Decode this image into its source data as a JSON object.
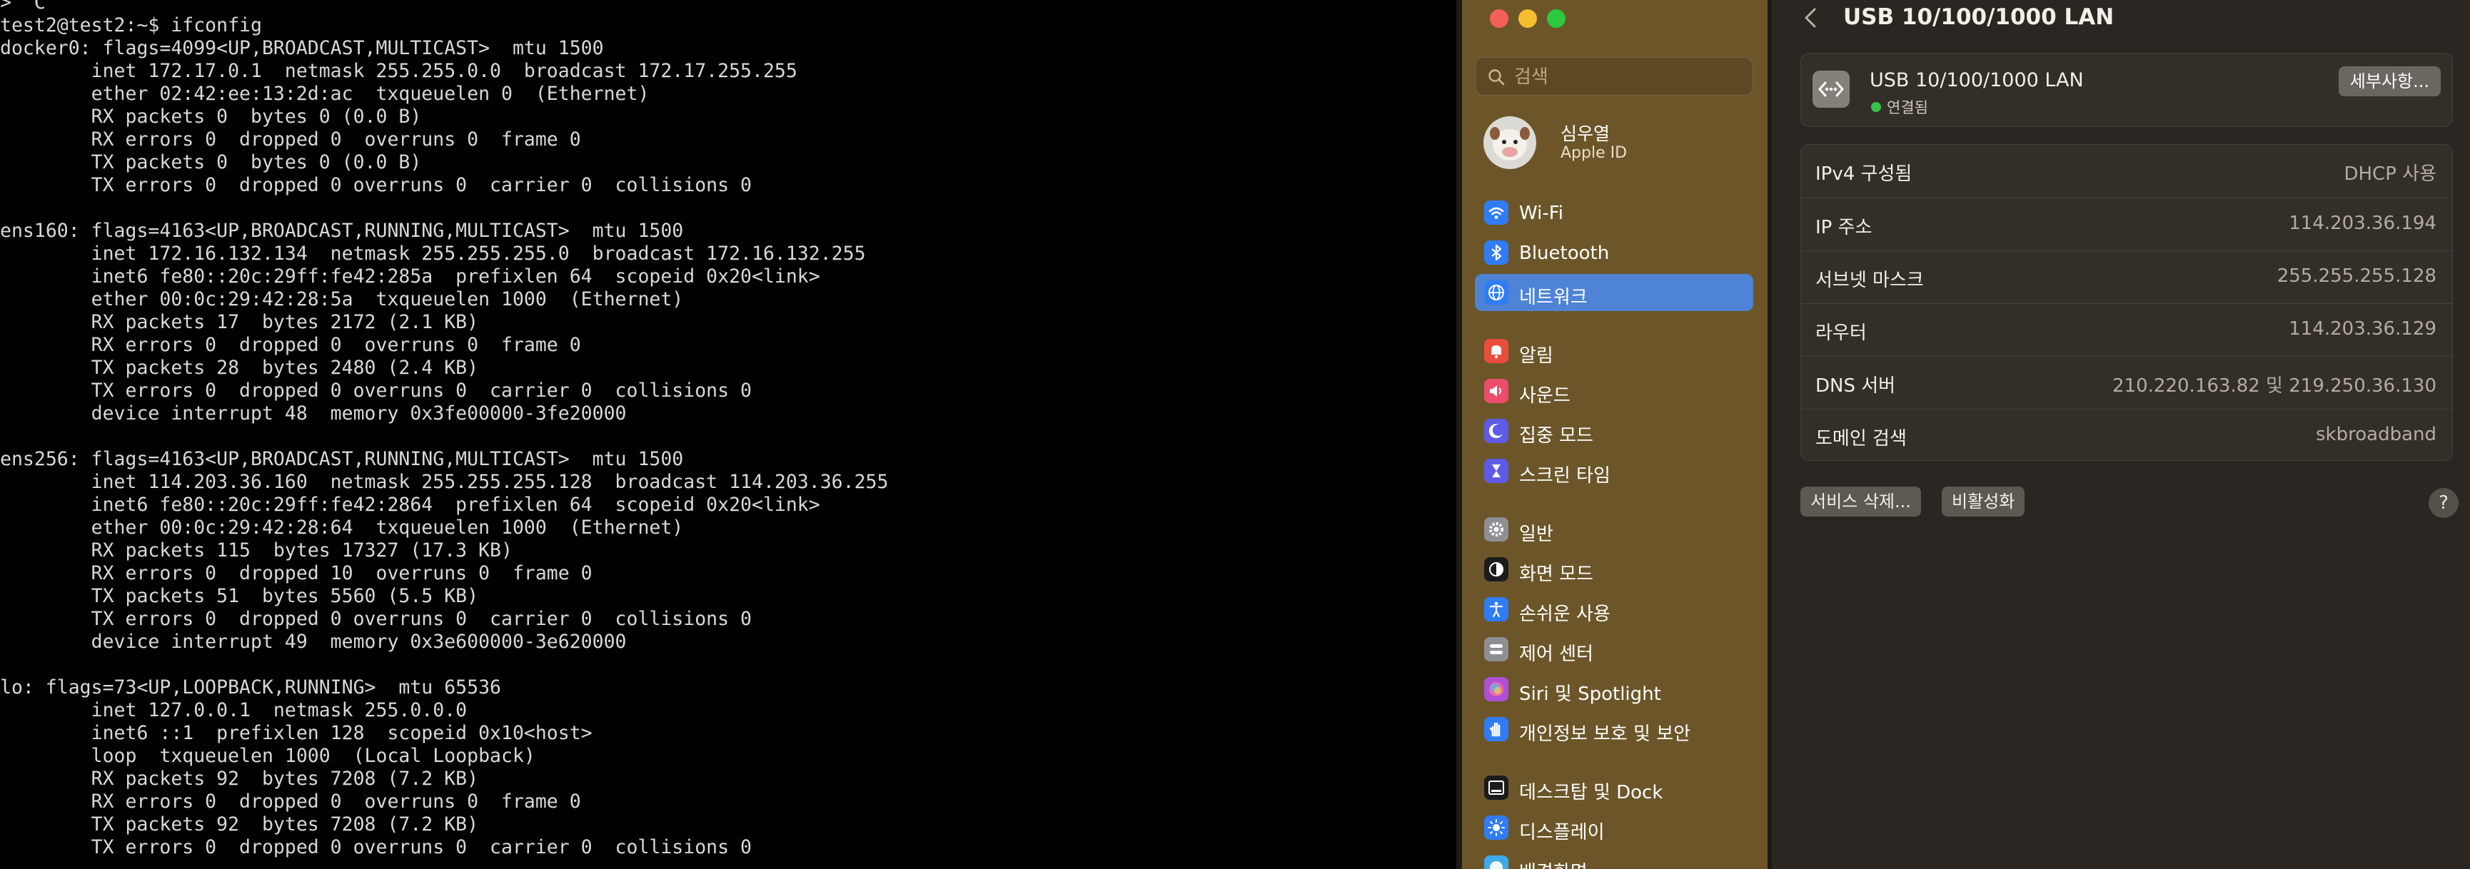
{
  "terminal": {
    "lines": [
      "> ^C",
      "test2@test2:~$ ifconfig",
      "docker0: flags=4099<UP,BROADCAST,MULTICAST>  mtu 1500",
      "        inet 172.17.0.1  netmask 255.255.0.0  broadcast 172.17.255.255",
      "        ether 02:42:ee:13:2d:ac  txqueuelen 0  (Ethernet)",
      "        RX packets 0  bytes 0 (0.0 B)",
      "        RX errors 0  dropped 0  overruns 0  frame 0",
      "        TX packets 0  bytes 0 (0.0 B)",
      "        TX errors 0  dropped 0 overruns 0  carrier 0  collisions 0",
      "",
      "ens160: flags=4163<UP,BROADCAST,RUNNING,MULTICAST>  mtu 1500",
      "        inet 172.16.132.134  netmask 255.255.255.0  broadcast 172.16.132.255",
      "        inet6 fe80::20c:29ff:fe42:285a  prefixlen 64  scopeid 0x20<link>",
      "        ether 00:0c:29:42:28:5a  txqueuelen 1000  (Ethernet)",
      "        RX packets 17  bytes 2172 (2.1 KB)",
      "        RX errors 0  dropped 0  overruns 0  frame 0",
      "        TX packets 28  bytes 2480 (2.4 KB)",
      "        TX errors 0  dropped 0 overruns 0  carrier 0  collisions 0",
      "        device interrupt 48  memory 0x3fe00000-3fe20000",
      "",
      "ens256: flags=4163<UP,BROADCAST,RUNNING,MULTICAST>  mtu 1500",
      "        inet 114.203.36.160  netmask 255.255.255.128  broadcast 114.203.36.255",
      "        inet6 fe80::20c:29ff:fe42:2864  prefixlen 64  scopeid 0x20<link>",
      "        ether 00:0c:29:42:28:64  txqueuelen 1000  (Ethernet)",
      "        RX packets 115  bytes 17327 (17.3 KB)",
      "        RX errors 0  dropped 10  overruns 0  frame 0",
      "        TX packets 51  bytes 5560 (5.5 KB)",
      "        TX errors 0  dropped 0 overruns 0  carrier 0  collisions 0",
      "        device interrupt 49  memory 0x3e600000-3e620000",
      "",
      "lo: flags=73<UP,LOOPBACK,RUNNING>  mtu 65536",
      "        inet 127.0.0.1  netmask 255.0.0.0",
      "        inet6 ::1  prefixlen 128  scopeid 0x10<host>",
      "        loop  txqueuelen 1000  (Local Loopback)",
      "        RX packets 92  bytes 7208 (7.2 KB)",
      "        RX errors 0  dropped 0  overruns 0  frame 0",
      "        TX packets 92  bytes 7208 (7.2 KB)",
      "        TX errors 0  dropped 0 overruns 0  carrier 0  collisions 0"
    ]
  },
  "sidebar": {
    "search_placeholder": "검색",
    "profile": {
      "name": "심우열",
      "subtitle": "Apple ID"
    },
    "items": [
      {
        "label": "Wi-Fi",
        "icon": "wifi-icon",
        "color": "#2f7cf6"
      },
      {
        "label": "Bluetooth",
        "icon": "bluetooth-icon",
        "color": "#2f7cf6"
      },
      {
        "label": "네트워크",
        "icon": "globe-icon",
        "color": "#2f7cf6",
        "selected": true
      },
      {
        "label": "알림",
        "icon": "bell-icon",
        "color": "#eb4d3d"
      },
      {
        "label": "사운드",
        "icon": "speaker-icon",
        "color": "#eb4d6a"
      },
      {
        "label": "집중 모드",
        "icon": "moon-icon",
        "color": "#5e5ce6"
      },
      {
        "label": "스크린 타임",
        "icon": "hourglass-icon",
        "color": "#5e5ce6"
      },
      {
        "label": "일반",
        "icon": "gear-icon",
        "color": "#8e8e93"
      },
      {
        "label": "화면 모드",
        "icon": "appearance-icon",
        "color": "#1c1c1e"
      },
      {
        "label": "손쉬운 사용",
        "icon": "accessibility-icon",
        "color": "#2f7cf6"
      },
      {
        "label": "제어 센터",
        "icon": "control-center-icon",
        "color": "#8e8e93"
      },
      {
        "label": "Siri 및 Spotlight",
        "icon": "siri-icon",
        "color": "#b04fd6"
      },
      {
        "label": "개인정보 보호 및 보안",
        "icon": "hand-icon",
        "color": "#2f7cf6"
      },
      {
        "label": "데스크탑 및 Dock",
        "icon": "dock-icon",
        "color": "#1c1c1e"
      },
      {
        "label": "디스플레이",
        "icon": "sun-icon",
        "color": "#2f7cf6"
      },
      {
        "label": "배경화면",
        "icon": "wallpaper-icon",
        "color": "#3fa8e8"
      }
    ]
  },
  "detail": {
    "title": "USB 10/100/1000 LAN",
    "interface": {
      "name": "USB 10/100/1000 LAN",
      "status": "연결됨",
      "details_button": "세부사항..."
    },
    "rows": [
      {
        "label": "IPv4 구성됨",
        "value": "DHCP 사용"
      },
      {
        "label": "IP 주소",
        "value": "114.203.36.194"
      },
      {
        "label": "서브넷 마스크",
        "value": "255.255.255.128"
      },
      {
        "label": "라우터",
        "value": "114.203.36.129"
      },
      {
        "label": "DNS 서버",
        "value": "210.220.163.82 및 219.250.36.130"
      },
      {
        "label": "도메인 검색",
        "value": "skbroadband"
      }
    ],
    "remove_service_button": "서비스 삭제...",
    "deactivate_button": "비활성화",
    "help_button": "?"
  },
  "colors": {
    "sidebar_bg": "#6c5629",
    "detail_bg": "#2b2621",
    "accent": "#4e83d6",
    "connected": "#35c24a"
  }
}
